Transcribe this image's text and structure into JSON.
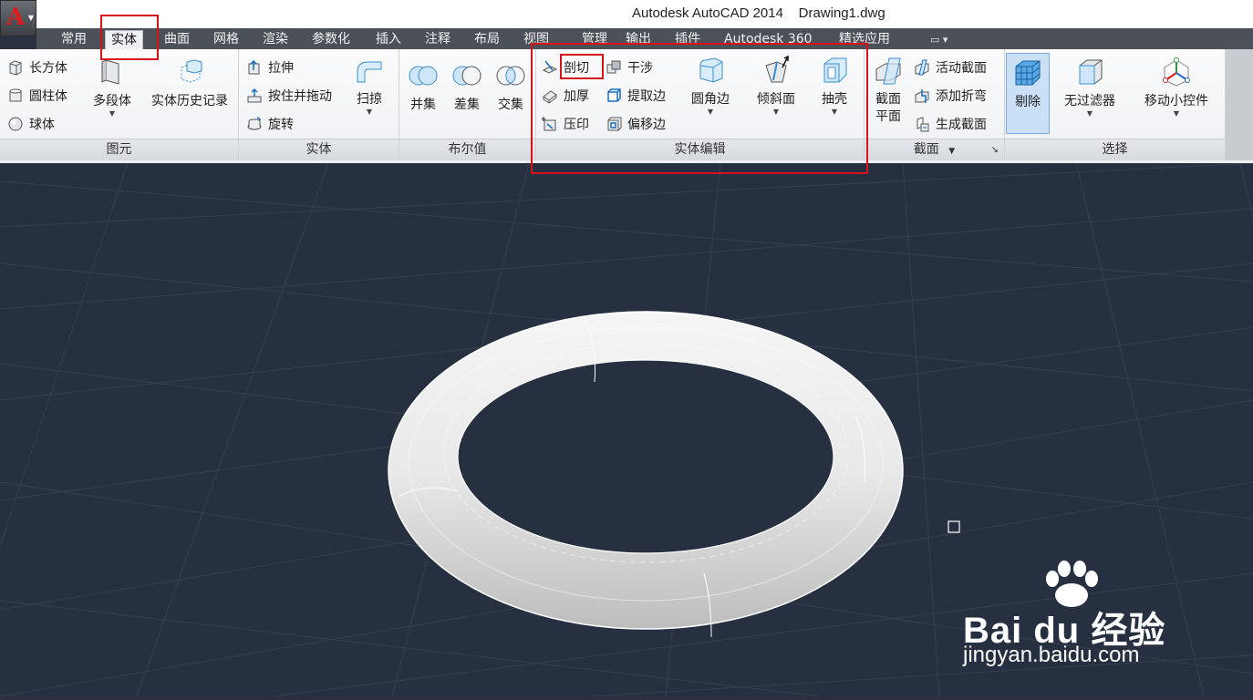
{
  "window": {
    "app_logo": "A",
    "title": "Autodesk AutoCAD 2014    Drawing1.dwg"
  },
  "tabs": [
    "常用",
    "实体",
    "曲面",
    "网格",
    "渲染",
    "参数化",
    "插入",
    "注释",
    "布局",
    "视图",
    "管理",
    "输出",
    "插件",
    "Autodesk 360",
    "精选应用"
  ],
  "active_tab": "实体",
  "panels": {
    "primitive": {
      "title": "图元",
      "box": "长方体",
      "cylinder": "圆柱体",
      "sphere": "球体",
      "polysolid": "多段体",
      "history": "实体历史记录"
    },
    "solid": {
      "title": "实体",
      "extrude": "拉伸",
      "presspull": "按住并拖动",
      "revolve": "旋转",
      "sweep": "扫掠"
    },
    "boolean": {
      "title": "布尔值",
      "union": "并集",
      "subtract": "差集",
      "intersect": "交集"
    },
    "solid_editing": {
      "title": "实体编辑",
      "slice": "剖切",
      "interfere": "干涉",
      "thicken": "加厚",
      "extract_edges": "提取边",
      "imprint": "压印",
      "offset_edge": "偏移边",
      "fillet_edge": "圆角边",
      "taper_faces": "倾斜面",
      "shell": "抽壳"
    },
    "section": {
      "title": "截面",
      "section_plane_1": "截面",
      "section_plane_2": "平面",
      "live_section": "活动截面",
      "add_jog": "添加折弯",
      "generate_section": "生成截面"
    },
    "selection": {
      "title": "选择",
      "culling": "剔除",
      "no_filter": "无过滤器",
      "gizmo": "移动小控件"
    }
  },
  "watermark": {
    "brand": "Bai du 经验",
    "url": "jingyan.baidu.com"
  },
  "colors": {
    "highlight_red": "#d8121b",
    "canvas_bg": "#263040",
    "grid_line": "#36404f",
    "tab_bar": "#4b5059"
  }
}
